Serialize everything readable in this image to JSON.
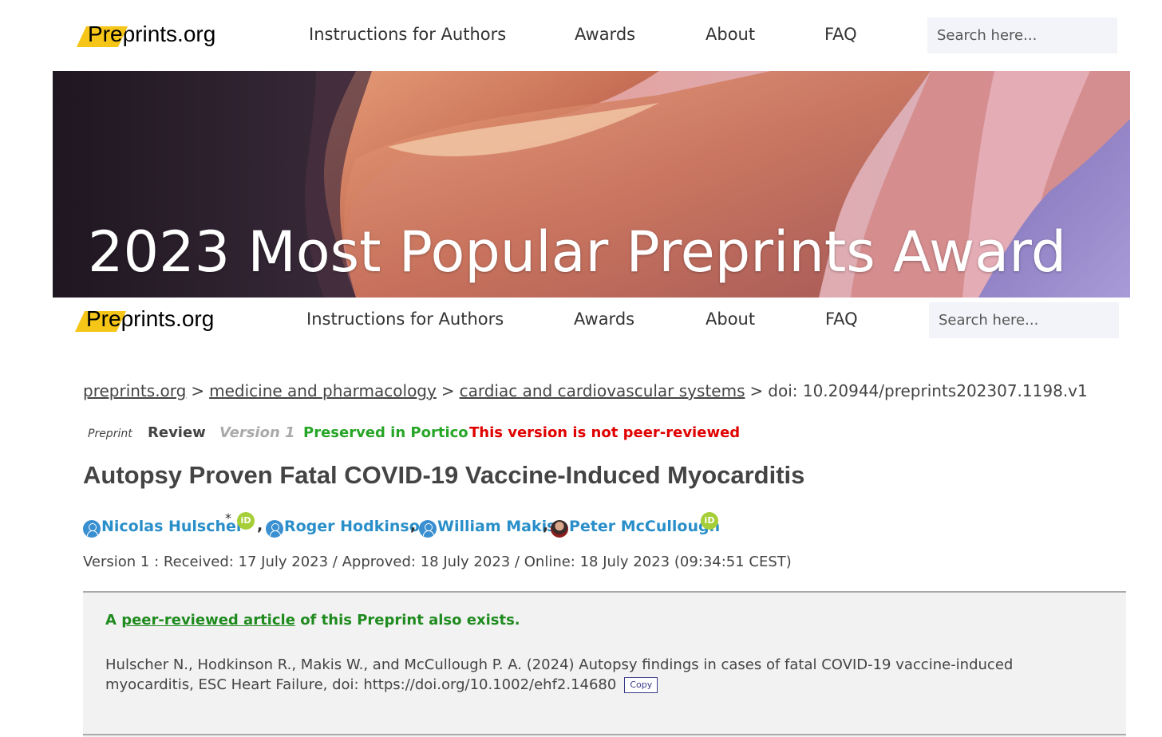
{
  "site": {
    "logo_pre": "Pre",
    "logo_rest": "prints.org",
    "nav": [
      "Instructions for Authors",
      "Awards",
      "About",
      "FAQ"
    ],
    "search_placeholder": "Search here..."
  },
  "banner": {
    "title": "2023 Most Popular Preprints Award",
    "colors": {
      "rock_dark": "#2a1f2a",
      "rock_orange": "#c8765a",
      "rock_pink": "#e7a79a",
      "rock_purple": "#8a7fc0"
    }
  },
  "breadcrumb": {
    "items": [
      "preprints.org",
      "medicine and pharmacology",
      "cardiac and cardiovascular systems"
    ],
    "separator": ">",
    "doi": "doi: 10.20944/preprints202307.1198.v1"
  },
  "tags": {
    "preprint": "Preprint",
    "review": "Review",
    "version": "Version 1",
    "portico": "Preserved in Portico",
    "not_peer": "This version is not peer-reviewed"
  },
  "article": {
    "title": "Autopsy Proven Fatal COVID-19 Vaccine-Induced Myocarditis",
    "authors": [
      {
        "name": "Nicolas Hulscher",
        "marker": "*",
        "orcid": "iD"
      },
      {
        "name": "Roger Hodkinson"
      },
      {
        "name": "William Makis"
      },
      {
        "name": "Peter McCullough",
        "orcid": "iD"
      }
    ],
    "author_separator": ",",
    "version_line": "Version 1 : Received: 17 July 2023 / Approved: 18 July 2023 / Online: 18 July 2023 (09:34:51 CEST)"
  },
  "peer_reviewed": {
    "prefix": "A",
    "link_text": "peer-reviewed article",
    "suffix": "of this Preprint also exists.",
    "citation": "Hulscher N., Hodkinson R., Makis W., and McCullough P. A. (2024) Autopsy findings in cases of fatal COVID-19 vaccine-induced myocarditis, ESC Heart Failure, doi: https://doi.org/10.1002/ehf2.14680",
    "copy_label": "Copy"
  },
  "colors": {
    "link_blue": "#2a8fc9",
    "portico_green": "#27a527",
    "warning_red": "#e00000",
    "logo_yellow": "#f5c518",
    "orcid_green": "#a6ce39"
  }
}
